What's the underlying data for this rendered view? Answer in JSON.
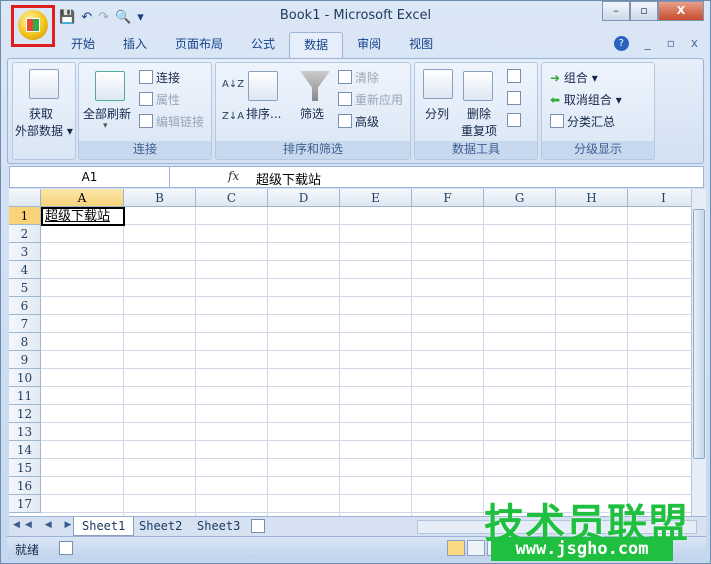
{
  "window": {
    "title": "Book1 - Microsoft Excel",
    "minimize": "–",
    "restore": "▫",
    "close": "X"
  },
  "qat": {
    "save": "💾",
    "undo": "↶",
    "redo": "↷",
    "preview": "🔍",
    "more": "▾"
  },
  "tabs": [
    "开始",
    "插入",
    "页面布局",
    "公式",
    "数据",
    "审阅",
    "视图"
  ],
  "active_tab": "数据",
  "ribbon_controls": {
    "help": "?",
    "min": "_",
    "restore": "▫",
    "close": "x"
  },
  "ribbon": {
    "get_external": {
      "line1": "获取",
      "line2": "外部数据 ▾"
    },
    "connections": {
      "refresh_all": "全部刷新",
      "refresh_arrow": "▾",
      "connections": "连接",
      "properties": "属性",
      "edit_links": "编辑链接",
      "label": "连接"
    },
    "sort_filter": {
      "az": "A↓Z",
      "za": "Z↓A",
      "sort": "排序...",
      "filter": "筛选",
      "clear": "清除",
      "reapply": "重新应用",
      "advanced": "高级",
      "label": "排序和筛选"
    },
    "data_tools": {
      "text_to_columns": "分列",
      "remove_dup_1": "删除",
      "remove_dup_2": "重复项",
      "label": "数据工具"
    },
    "outline": {
      "group": "组合 ▾",
      "ungroup": "取消组合 ▾",
      "subtotal": "分类汇总",
      "label": "分级显示"
    }
  },
  "formula_bar": {
    "name_box": "A1",
    "fx": "fx",
    "value": "超级下载站"
  },
  "columns": [
    "A",
    "B",
    "C",
    "D",
    "E",
    "F",
    "G",
    "H",
    "I"
  ],
  "rows": [
    "1",
    "2",
    "3",
    "4",
    "5",
    "6",
    "7",
    "8",
    "9",
    "10",
    "11",
    "12",
    "13",
    "14",
    "15",
    "16",
    "17"
  ],
  "cells": {
    "A1": "超级下载站"
  },
  "sheets": [
    "Sheet1",
    "Sheet2",
    "Sheet3"
  ],
  "active_sheet": "Sheet1",
  "sheet_nav": "◀◀ ◀ ▶ ▶▶",
  "status": {
    "ready": "就绪"
  },
  "watermark": {
    "line1": "技术员联盟",
    "line2": "www.jsgho.com"
  }
}
